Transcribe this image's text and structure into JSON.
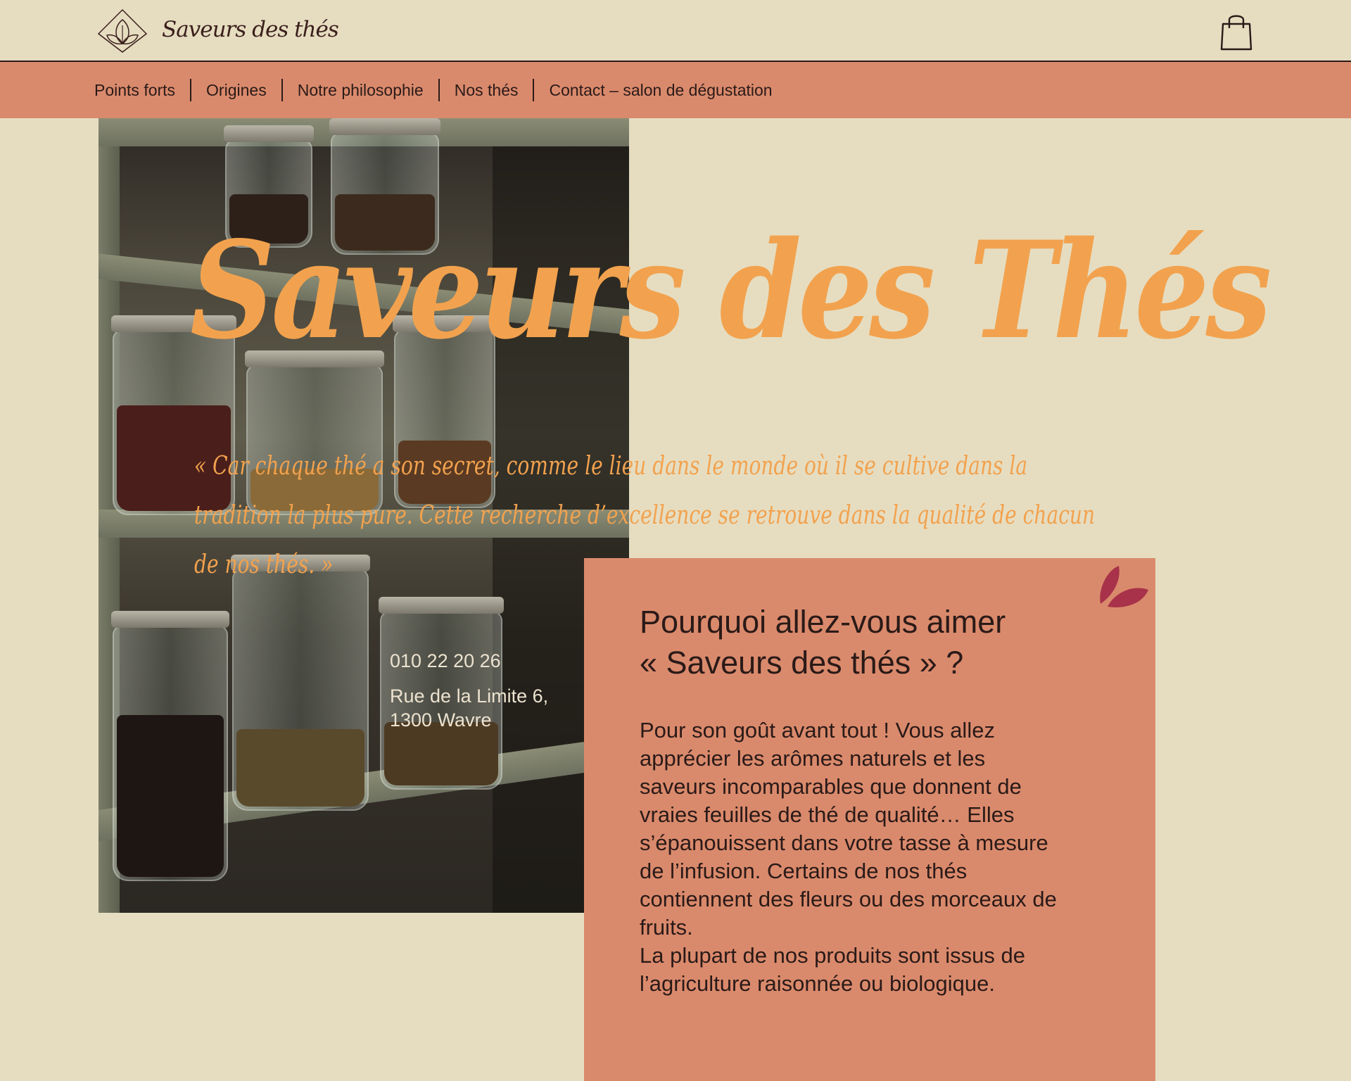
{
  "header": {
    "brand": "Saveurs des thés",
    "logo_icon": "tea-leaf-diamond-logo-icon",
    "cart_icon": "shopping-bag-icon"
  },
  "nav": {
    "items": [
      {
        "label": "Points forts"
      },
      {
        "label": "Origines"
      },
      {
        "label": "Notre philosophie"
      },
      {
        "label": "Nos thés"
      },
      {
        "label": "Contact – salon de dégustation"
      }
    ]
  },
  "hero": {
    "title": "Saveurs des Thés",
    "quote": "« Car chaque thé a son secret, comme le lieu dans le monde où il se cultive dans la tradition la plus pure. Cette recherche d’excellence se retrouve dans la qualité de chacun de nos thés. »",
    "phone": "010 22 20 26",
    "address_line1": "Rue de la Limite 6,",
    "address_line2": "1300 Wavre"
  },
  "card": {
    "title_line1": "Pourquoi allez-vous aimer",
    "title_line2": "« Saveurs des thés » ?",
    "paragraph1": "Pour son goût avant tout ! Vous allez apprécier les arômes naturels et les saveurs incomparables que donnent de vraies feuilles de thé de qualité… Elles s’épanouissent dans votre tasse à mesure de l’infusion. Certains de nos thés contiennent des fleurs ou des morceaux de fruits.",
    "paragraph2": "La plupart de nos produits sont issus de l’agriculture raisonnée ou biologique.",
    "leaf_icon": "leaf-icon"
  },
  "colors": {
    "background": "#e6ddc1",
    "nav_bg": "#da8a6c",
    "accent_orange": "#f2a24e",
    "leaf": "#a8324a",
    "text_dark": "#2a1a18"
  }
}
